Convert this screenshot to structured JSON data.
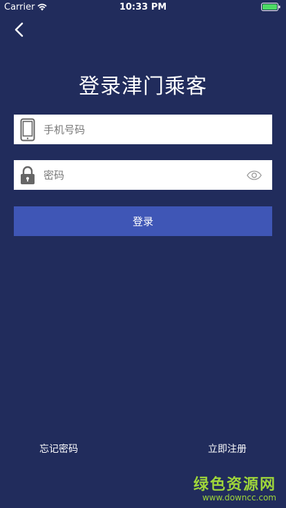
{
  "status_bar": {
    "carrier": "Carrier",
    "time": "10:33 PM"
  },
  "header": {
    "title": "登录津门乘客"
  },
  "form": {
    "phone_placeholder": "手机号码",
    "phone_value": "",
    "password_placeholder": "密码",
    "password_value": "",
    "login_label": "登录"
  },
  "footer": {
    "forgot_password": "忘记密码",
    "register": "立即注册"
  },
  "watermark": {
    "name": "绿色资源网",
    "url": "www.downcc.com"
  },
  "colors": {
    "background": "#212c5c",
    "button": "#3f56b6",
    "watermark": "#9fd63a"
  }
}
